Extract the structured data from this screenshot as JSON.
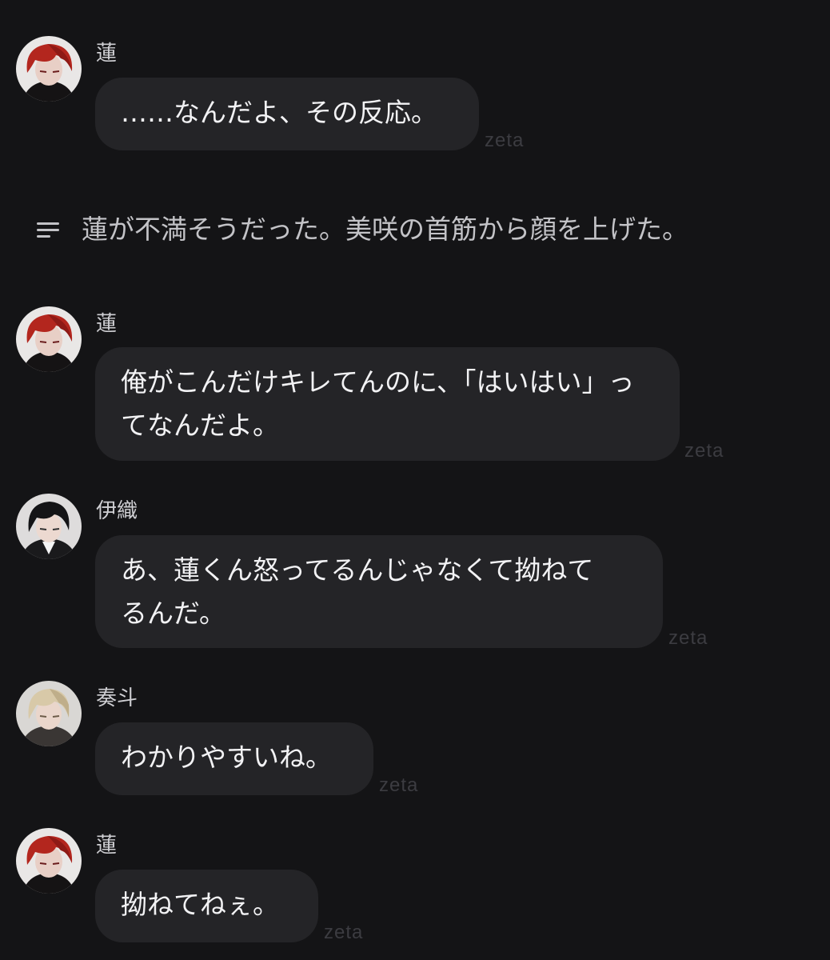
{
  "messages": [
    {
      "speaker": "蓮",
      "text": "……なんだよ、その反応。",
      "watermark": "zeta",
      "avatar": "red-hair-character-avatar"
    },
    {
      "speaker": "蓮",
      "text": "俺がこんだけキレてんのに、「はいはい」っ\nてなんだよ。",
      "watermark": "zeta",
      "avatar": "red-hair-character-avatar"
    },
    {
      "speaker": "伊織",
      "text": "あ、蓮くん怒ってるんじゃなくて拗ねて\nるんだ。",
      "watermark": "zeta",
      "avatar": "black-hair-character-avatar"
    },
    {
      "speaker": "奏斗",
      "text": "わかりやすいね。",
      "watermark": "zeta",
      "avatar": "blonde-hair-character-avatar"
    },
    {
      "speaker": "蓮",
      "text": "拗ねてねぇ。",
      "watermark": "zeta",
      "avatar": "red-hair-character-avatar"
    }
  ],
  "narration": {
    "icon": "narration-lines-icon",
    "text": "蓮が不満そうだった。美咲の首筋から顔を上げた。"
  },
  "colors": {
    "background": "#141416",
    "bubble": "#242427",
    "text": "#f2f2f4",
    "name": "#cfcfd3",
    "watermark": "#3c3c41"
  }
}
